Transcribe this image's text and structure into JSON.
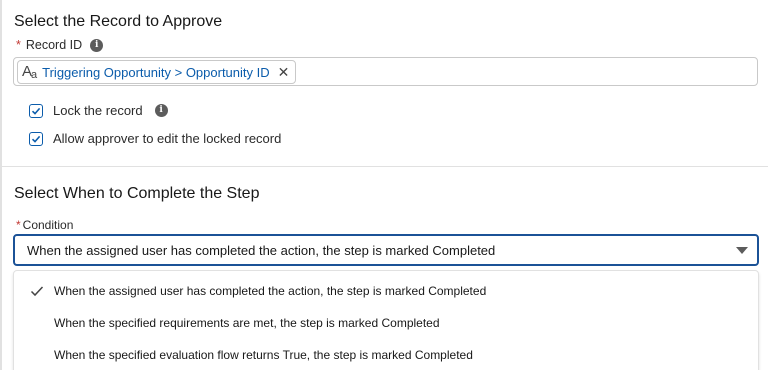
{
  "section1": {
    "title": "Select the Record to Approve",
    "required_marker": "*",
    "record_id_label": "Record ID",
    "record_pill": {
      "icon_glyph": "A",
      "icon_glyph_sub": "a",
      "icon_name": "text-type-icon",
      "text": "Triggering Opportunity > Opportunity ID",
      "remove_glyph": "✕"
    },
    "checkboxes": [
      {
        "label": "Lock the record",
        "checked": true,
        "has_info": true
      },
      {
        "label": "Allow approver to edit the locked record",
        "checked": true,
        "has_info": false
      }
    ]
  },
  "section2": {
    "title": "Select When to Complete the Step",
    "required_marker": "*",
    "condition_label": "Condition",
    "selected_value": "When the assigned user has completed the action, the step is marked Completed",
    "options": [
      {
        "label": "When the assigned user has completed the action, the step is marked Completed",
        "selected": true
      },
      {
        "label": "When the specified requirements are met, the step is marked Completed",
        "selected": false
      },
      {
        "label": "When the specified evaluation flow returns True, the step is marked Completed",
        "selected": false
      }
    ]
  },
  "info_glyph": "i",
  "colors": {
    "required": "#c23934",
    "link_blue": "#0b5cab",
    "focus_border": "#1b5297",
    "border": "#c9c9c9"
  }
}
